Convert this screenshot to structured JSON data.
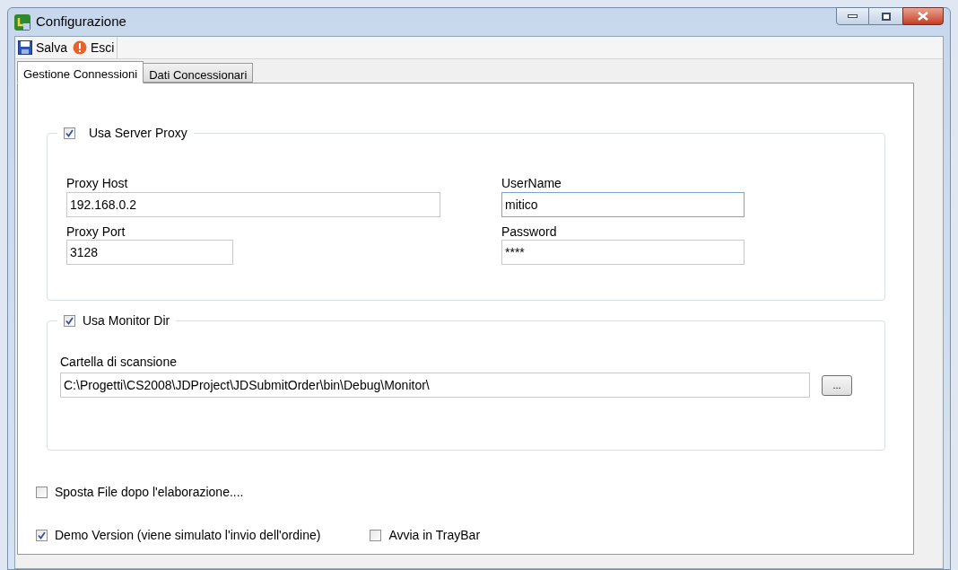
{
  "window": {
    "title": "Configurazione"
  },
  "toolbar": [
    {
      "kind": "save",
      "label": "Salva"
    },
    {
      "kind": "exit",
      "label": "Esci"
    }
  ],
  "tabs": [
    {
      "label": "Gestione Connessioni",
      "selected": true
    },
    {
      "label": "Dati Concessionari",
      "selected": false
    }
  ],
  "proxy_group": {
    "label": "Usa Server Proxy",
    "checked": true,
    "host_label": "Proxy Host",
    "host": "192.168.0.2",
    "port_label": "Proxy Port",
    "port": "3128",
    "user_label": "UserName",
    "user": "mitico",
    "password_label": "Password",
    "password": "****"
  },
  "monitor_group": {
    "label": "Usa Monitor Dir",
    "checked": true,
    "folder_label": "Cartella di scansione",
    "folder": "C:\\Progetti\\CS2008\\JDProject\\JDSubmitOrder\\bin\\Debug\\Monitor\\",
    "browse": "..."
  },
  "options": [
    {
      "label": "Sposta File dopo l'elaborazione....",
      "checked": false
    },
    {
      "label": "Demo Version (viene simulato l'invio dell'ordine)",
      "checked": true
    },
    {
      "label": "Avvia in TrayBar",
      "checked": false
    }
  ]
}
